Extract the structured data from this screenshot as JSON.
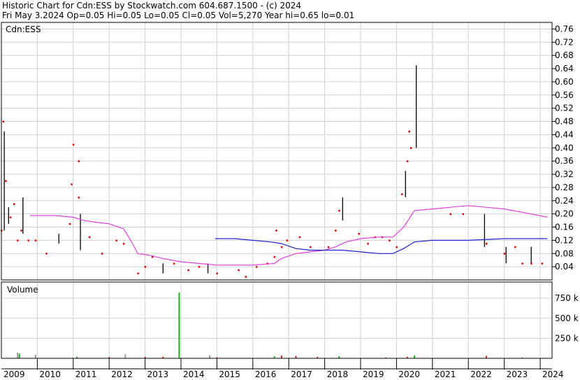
{
  "header": {
    "line1": "Historic Chart for Cdn:ESS by Stockwatch.com 604.687.1500 - (c) 2024",
    "line2": "Fri May  3.2024   Op=0.05  Hi=0.05  Lo=0.05  Cl=0.05  Vol=5,270  Year hi=0.65  lo=0.01"
  },
  "chart_data": {
    "type": "bar",
    "symbol_label": "Cdn:ESS",
    "x_ticks": [
      "2009",
      "2010",
      "2011",
      "2012",
      "2013",
      "2014",
      "2015",
      "2016",
      "2017",
      "2018",
      "2019",
      "2020",
      "2021",
      "2022",
      "2023",
      "2024"
    ],
    "price_axis": {
      "ylim": [
        0.0,
        0.78
      ],
      "ticks": [
        "0.04",
        "0.08",
        "0.12",
        "0.16",
        "0.20",
        "0.24",
        "0.28",
        "0.32",
        "0.36",
        "0.40",
        "0.44",
        "0.48",
        "0.52",
        "0.56",
        "0.60",
        "0.64",
        "0.68",
        "0.72",
        "0.76"
      ]
    },
    "volume_axis": {
      "title": "Volume",
      "ylim": [
        0,
        900000
      ],
      "ticks": [
        "250 k",
        "500 k",
        "750 k"
      ],
      "tick_values": [
        250000,
        500000,
        750000
      ]
    },
    "price_bars": [
      {
        "t": 2009.08,
        "hi": 0.45,
        "lo": 0.15
      },
      {
        "t": 2009.2,
        "hi": 0.22,
        "lo": 0.17
      },
      {
        "t": 2009.6,
        "hi": 0.25,
        "lo": 0.14
      },
      {
        "t": 2010.6,
        "hi": 0.14,
        "lo": 0.11
      },
      {
        "t": 2011.2,
        "hi": 0.2,
        "lo": 0.09
      },
      {
        "t": 2013.5,
        "hi": 0.05,
        "lo": 0.02
      },
      {
        "t": 2014.75,
        "hi": 0.05,
        "lo": 0.02
      },
      {
        "t": 2018.5,
        "hi": 0.25,
        "lo": 0.18
      },
      {
        "t": 2020.25,
        "hi": 0.33,
        "lo": 0.25
      },
      {
        "t": 2020.55,
        "hi": 0.65,
        "lo": 0.4
      },
      {
        "t": 2022.45,
        "hi": 0.2,
        "lo": 0.1
      },
      {
        "t": 2023.05,
        "hi": 0.1,
        "lo": 0.05
      },
      {
        "t": 2023.75,
        "hi": 0.1,
        "lo": 0.05
      }
    ],
    "closes": [
      {
        "t": 2009.0,
        "v": 0.15
      },
      {
        "t": 2009.05,
        "v": 0.48
      },
      {
        "t": 2009.12,
        "v": 0.3
      },
      {
        "t": 2009.25,
        "v": 0.19
      },
      {
        "t": 2009.35,
        "v": 0.23
      },
      {
        "t": 2009.45,
        "v": 0.12
      },
      {
        "t": 2009.55,
        "v": 0.15
      },
      {
        "t": 2009.75,
        "v": 0.12
      },
      {
        "t": 2009.95,
        "v": 0.12
      },
      {
        "t": 2010.25,
        "v": 0.08
      },
      {
        "t": 2010.9,
        "v": 0.17
      },
      {
        "t": 2011.0,
        "v": 0.41
      },
      {
        "t": 2010.95,
        "v": 0.29
      },
      {
        "t": 2011.15,
        "v": 0.36
      },
      {
        "t": 2011.15,
        "v": 0.25
      },
      {
        "t": 2011.45,
        "v": 0.13
      },
      {
        "t": 2011.8,
        "v": 0.08
      },
      {
        "t": 2012.2,
        "v": 0.12
      },
      {
        "t": 2012.4,
        "v": 0.11
      },
      {
        "t": 2012.8,
        "v": 0.02
      },
      {
        "t": 2013.0,
        "v": 0.04
      },
      {
        "t": 2013.2,
        "v": 0.07
      },
      {
        "t": 2013.8,
        "v": 0.05
      },
      {
        "t": 2014.2,
        "v": 0.03
      },
      {
        "t": 2014.5,
        "v": 0.04
      },
      {
        "t": 2015.0,
        "v": 0.02
      },
      {
        "t": 2015.6,
        "v": 0.03
      },
      {
        "t": 2015.8,
        "v": 0.01
      },
      {
        "t": 2016.1,
        "v": 0.04
      },
      {
        "t": 2016.4,
        "v": 0.05
      },
      {
        "t": 2016.6,
        "v": 0.07
      },
      {
        "t": 2016.65,
        "v": 0.15
      },
      {
        "t": 2016.8,
        "v": 0.1
      },
      {
        "t": 2016.95,
        "v": 0.12
      },
      {
        "t": 2017.3,
        "v": 0.13
      },
      {
        "t": 2017.6,
        "v": 0.1
      },
      {
        "t": 2018.1,
        "v": 0.1
      },
      {
        "t": 2018.3,
        "v": 0.15
      },
      {
        "t": 2018.4,
        "v": 0.21
      },
      {
        "t": 2018.95,
        "v": 0.14
      },
      {
        "t": 2019.2,
        "v": 0.11
      },
      {
        "t": 2019.4,
        "v": 0.13
      },
      {
        "t": 2019.6,
        "v": 0.13
      },
      {
        "t": 2019.8,
        "v": 0.12
      },
      {
        "t": 2020.0,
        "v": 0.1
      },
      {
        "t": 2020.15,
        "v": 0.26
      },
      {
        "t": 2020.3,
        "v": 0.36
      },
      {
        "t": 2020.35,
        "v": 0.45
      },
      {
        "t": 2020.4,
        "v": 0.4
      },
      {
        "t": 2021.5,
        "v": 0.2
      },
      {
        "t": 2021.85,
        "v": 0.2
      },
      {
        "t": 2022.5,
        "v": 0.11
      },
      {
        "t": 2023.0,
        "v": 0.08
      },
      {
        "t": 2023.3,
        "v": 0.1
      },
      {
        "t": 2023.5,
        "v": 0.05
      },
      {
        "t": 2023.75,
        "v": 0.05
      },
      {
        "t": 2024.05,
        "v": 0.05
      }
    ],
    "ma_long": {
      "color": "#e040e0",
      "points": [
        {
          "t": 2009.8,
          "v": 0.195
        },
        {
          "t": 2010.5,
          "v": 0.195
        },
        {
          "t": 2011.0,
          "v": 0.19
        },
        {
          "t": 2011.3,
          "v": 0.18
        },
        {
          "t": 2011.6,
          "v": 0.175
        },
        {
          "t": 2012.0,
          "v": 0.17
        },
        {
          "t": 2012.4,
          "v": 0.155
        },
        {
          "t": 2012.6,
          "v": 0.12
        },
        {
          "t": 2012.8,
          "v": 0.08
        },
        {
          "t": 2013.1,
          "v": 0.075
        },
        {
          "t": 2013.5,
          "v": 0.065
        },
        {
          "t": 2014.0,
          "v": 0.055
        },
        {
          "t": 2014.5,
          "v": 0.05
        },
        {
          "t": 2015.0,
          "v": 0.045
        },
        {
          "t": 2015.5,
          "v": 0.045
        },
        {
          "t": 2016.0,
          "v": 0.045
        },
        {
          "t": 2016.6,
          "v": 0.05
        },
        {
          "t": 2016.8,
          "v": 0.065
        },
        {
          "t": 2017.2,
          "v": 0.08
        },
        {
          "t": 2017.6,
          "v": 0.085
        },
        {
          "t": 2018.0,
          "v": 0.09
        },
        {
          "t": 2018.3,
          "v": 0.1
        },
        {
          "t": 2018.6,
          "v": 0.115
        },
        {
          "t": 2019.0,
          "v": 0.125
        },
        {
          "t": 2019.5,
          "v": 0.13
        },
        {
          "t": 2019.9,
          "v": 0.13
        },
        {
          "t": 2020.2,
          "v": 0.16
        },
        {
          "t": 2020.5,
          "v": 0.21
        },
        {
          "t": 2021.0,
          "v": 0.215
        },
        {
          "t": 2021.5,
          "v": 0.22
        },
        {
          "t": 2022.0,
          "v": 0.225
        },
        {
          "t": 2022.5,
          "v": 0.22
        },
        {
          "t": 2023.0,
          "v": 0.215
        },
        {
          "t": 2023.5,
          "v": 0.205
        },
        {
          "t": 2024.2,
          "v": 0.19
        }
      ]
    },
    "ma_short": {
      "color": "#2020cc",
      "points": [
        {
          "t": 2014.95,
          "v": 0.125
        },
        {
          "t": 2015.5,
          "v": 0.125
        },
        {
          "t": 2016.0,
          "v": 0.12
        },
        {
          "t": 2016.5,
          "v": 0.115
        },
        {
          "t": 2016.8,
          "v": 0.11
        },
        {
          "t": 2017.2,
          "v": 0.095
        },
        {
          "t": 2017.6,
          "v": 0.09
        },
        {
          "t": 2018.0,
          "v": 0.09
        },
        {
          "t": 2018.5,
          "v": 0.09
        },
        {
          "t": 2019.0,
          "v": 0.085
        },
        {
          "t": 2019.5,
          "v": 0.08
        },
        {
          "t": 2019.9,
          "v": 0.08
        },
        {
          "t": 2020.2,
          "v": 0.095
        },
        {
          "t": 2020.5,
          "v": 0.115
        },
        {
          "t": 2021.0,
          "v": 0.12
        },
        {
          "t": 2022.0,
          "v": 0.12
        },
        {
          "t": 2023.0,
          "v": 0.125
        },
        {
          "t": 2024.2,
          "v": 0.125
        }
      ]
    },
    "volume": [
      {
        "t": 2009.45,
        "v": 70000,
        "c": "gray"
      },
      {
        "t": 2009.5,
        "v": 60000,
        "c": "green"
      },
      {
        "t": 2009.95,
        "v": 45000,
        "c": "gray"
      },
      {
        "t": 2011.1,
        "v": 20000,
        "c": "green"
      },
      {
        "t": 2012.0,
        "v": 15000,
        "c": "red"
      },
      {
        "t": 2012.45,
        "v": 50000,
        "c": "gray"
      },
      {
        "t": 2013.0,
        "v": 18000,
        "c": "red"
      },
      {
        "t": 2013.5,
        "v": 20000,
        "c": "red"
      },
      {
        "t": 2013.95,
        "v": 820000,
        "c": "green"
      },
      {
        "t": 2014.8,
        "v": 40000,
        "c": "gray"
      },
      {
        "t": 2015.0,
        "v": 12000,
        "c": "red"
      },
      {
        "t": 2016.6,
        "v": 25000,
        "c": "green"
      },
      {
        "t": 2016.8,
        "v": 35000,
        "c": "red"
      },
      {
        "t": 2017.2,
        "v": 30000,
        "c": "red"
      },
      {
        "t": 2017.8,
        "v": 20000,
        "c": "red"
      },
      {
        "t": 2018.4,
        "v": 25000,
        "c": "green"
      },
      {
        "t": 2019.7,
        "v": 10000,
        "c": "red"
      },
      {
        "t": 2020.3,
        "v": 20000,
        "c": "red"
      },
      {
        "t": 2020.5,
        "v": 35000,
        "c": "green"
      },
      {
        "t": 2022.5,
        "v": 30000,
        "c": "red"
      },
      {
        "t": 2023.5,
        "v": 10000,
        "c": "green"
      }
    ]
  }
}
